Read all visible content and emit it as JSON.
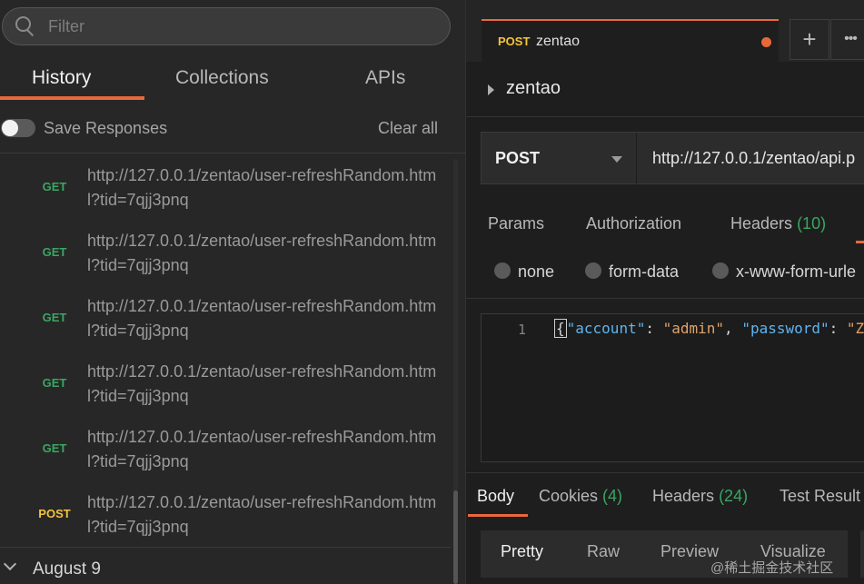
{
  "sidebar": {
    "filter_placeholder": "Filter",
    "tabs": [
      "History",
      "Collections",
      "APIs"
    ],
    "save_responses_label": "Save Responses",
    "clear_all_label": "Clear all",
    "history": [
      {
        "method": "GET",
        "url": "http://127.0.0.1/zentao/user-refreshRandom.html?tid=7qjj3pnq"
      },
      {
        "method": "GET",
        "url": "http://127.0.0.1/zentao/user-refreshRandom.html?tid=7qjj3pnq"
      },
      {
        "method": "GET",
        "url": "http://127.0.0.1/zentao/user-refreshRandom.html?tid=7qjj3pnq"
      },
      {
        "method": "GET",
        "url": "http://127.0.0.1/zentao/user-refreshRandom.html?tid=7qjj3pnq"
      },
      {
        "method": "GET",
        "url": "http://127.0.0.1/zentao/user-refreshRandom.html?tid=7qjj3pnq"
      },
      {
        "method": "POST",
        "url": "http://127.0.0.1/zentao/user-refreshRandom.html?tid=7qjj3pnq"
      }
    ],
    "date_group": "August 9"
  },
  "request_tab": {
    "method": "POST",
    "name": "zentao",
    "new_tab_icon": "plus-icon",
    "more_icon": "more-icon"
  },
  "request": {
    "title": "zentao",
    "method": "POST",
    "url": "http://127.0.0.1/zentao/api.p"
  },
  "request_tabs": {
    "params": "Params",
    "authorization": "Authorization",
    "headers": "Headers",
    "headers_count": "(10)"
  },
  "body_types": [
    "none",
    "form-data",
    "x-www-form-urle"
  ],
  "editor": {
    "line_number": "1",
    "key1": "\"account\"",
    "colon": ": ",
    "value1": "\"admin\"",
    "comma": ", ",
    "key2": "\"password\"",
    "value2_start": "\"Z"
  },
  "response_tabs": {
    "body": "Body",
    "cookies": "Cookies",
    "cookies_count": "(4)",
    "headers": "Headers",
    "headers_count": "(24)",
    "test_results": "Test Result"
  },
  "view_modes": [
    "Pretty",
    "Raw",
    "Preview",
    "Visualize"
  ],
  "watermark": "@稀土掘金技术社区",
  "colors": {
    "accent": "#e8683c",
    "get": "#3aa662",
    "post": "#f4c43a",
    "json_key": "#5eb4f0",
    "json_string": "#e0a36a"
  }
}
